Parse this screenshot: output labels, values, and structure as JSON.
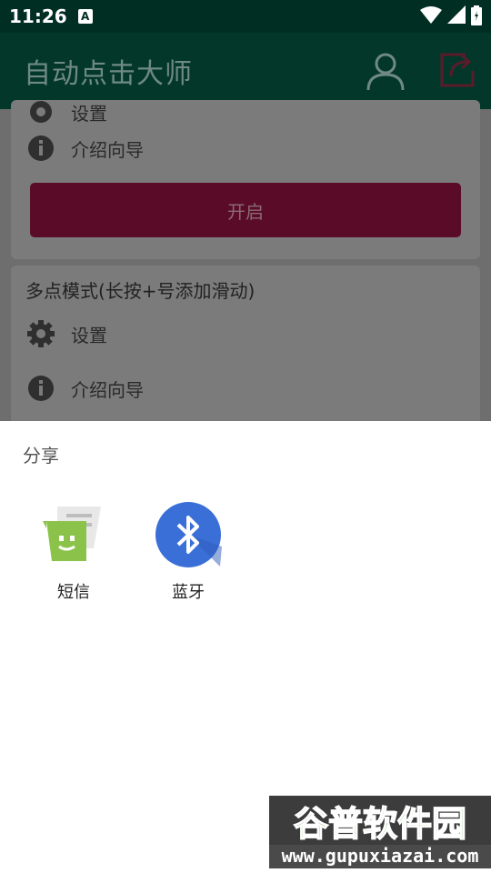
{
  "status": {
    "time": "11:26",
    "notification_badge": "A"
  },
  "toolbar": {
    "title": "自动点击大师"
  },
  "card1": {
    "settings_label": "设置",
    "guide_label": "介绍向导",
    "start_label": "开启"
  },
  "card2": {
    "title": "多点模式(长按+号添加滑动)",
    "settings_label": "设置",
    "guide_label": "介绍向导"
  },
  "share_sheet": {
    "title": "分享",
    "targets": [
      {
        "label": "短信",
        "icon": "messages-icon"
      },
      {
        "label": "蓝牙",
        "icon": "bluetooth-icon"
      }
    ]
  },
  "watermark": {
    "text": "谷普软件园",
    "url": "www.gupuxiazai.com"
  },
  "colors": {
    "toolbar": "#03372a",
    "status_bar": "#012e23",
    "start_button": "#5a0b27",
    "bluetooth": "#3a6fd8",
    "messages": "#8bc34a"
  }
}
